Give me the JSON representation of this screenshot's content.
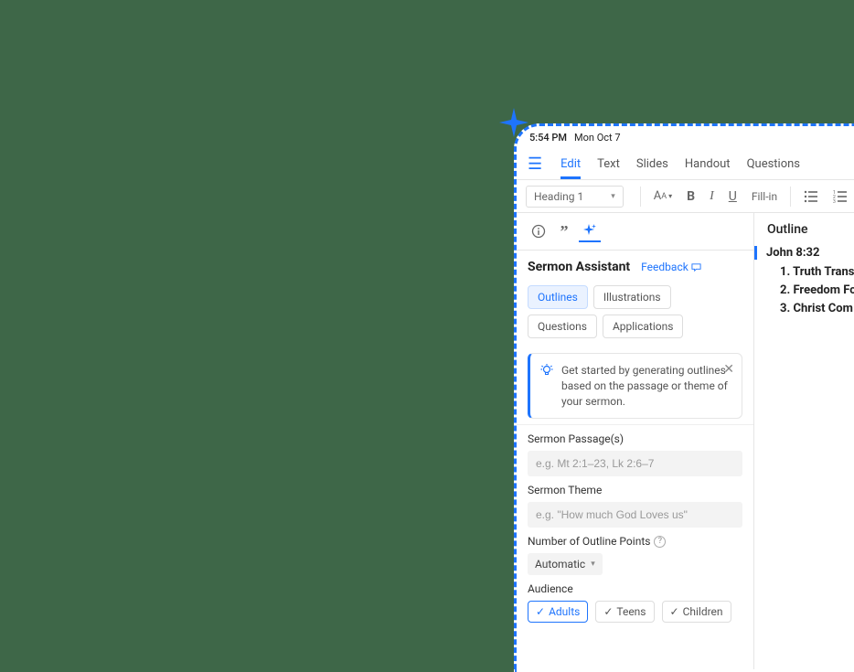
{
  "statusbar": {
    "time": "5:54 PM",
    "date": "Mon Oct 7"
  },
  "tabs": {
    "edit": "Edit",
    "text": "Text",
    "slides": "Slides",
    "handout": "Handout",
    "questions": "Questions"
  },
  "toolbar": {
    "heading_select": "Heading 1",
    "fillin": "Fill-in"
  },
  "assistant": {
    "title": "Sermon Assistant",
    "feedback": "Feedback",
    "pills": {
      "outlines": "Outlines",
      "illustrations": "Illustrations",
      "questions": "Questions",
      "applications": "Applications"
    },
    "hint": "Get started by generating outlines based on the passage or theme of your sermon.",
    "fields": {
      "passage_label": "Sermon Passage(s)",
      "passage_placeholder": "e.g. Mt 2:1–23, Lk 2:6–7",
      "theme_label": "Sermon Theme",
      "theme_placeholder": "e.g. \"How much God Loves us\"",
      "points_label": "Number of Outline Points",
      "points_value": "Automatic",
      "audience_label": "Audience",
      "audience_adults": "Adults",
      "audience_teens": "Teens",
      "audience_children": "Children"
    }
  },
  "outline": {
    "title": "Outline",
    "reference": "John 8:32",
    "items": [
      "1. Truth Trans",
      "2. Freedom Fo",
      "3. Christ Com"
    ]
  }
}
